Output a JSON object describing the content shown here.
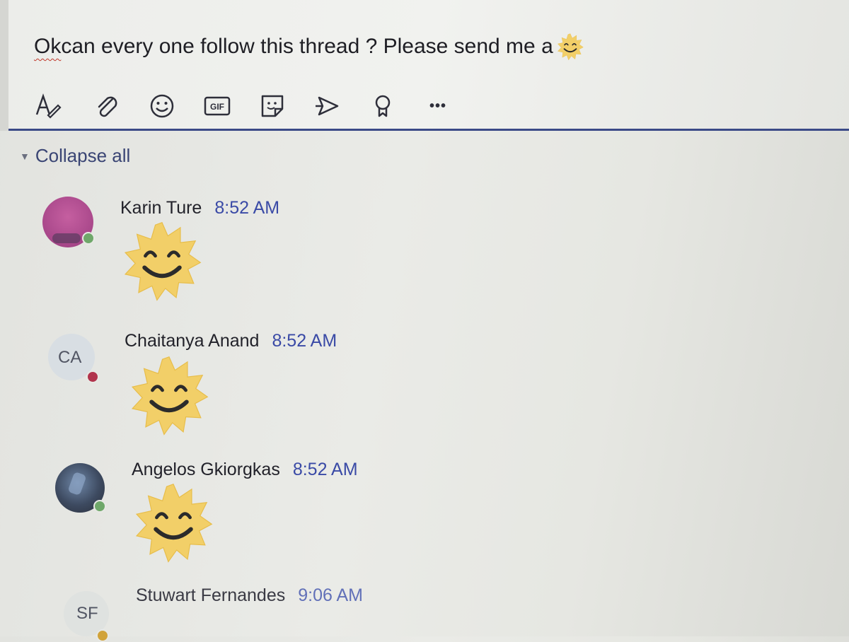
{
  "compose": {
    "text_first_word": "Ok",
    "text_rest": " can every one follow this thread ? Please send me a",
    "inline_emoji": "sun-smile-emoji"
  },
  "toolbar": {
    "items": [
      {
        "icon": "format-icon"
      },
      {
        "icon": "attach-icon"
      },
      {
        "icon": "emoji-icon"
      },
      {
        "icon": "gif-icon",
        "label": "GIF"
      },
      {
        "icon": "sticker-icon"
      },
      {
        "icon": "meet-icon"
      },
      {
        "icon": "praise-icon"
      },
      {
        "icon": "more-icon",
        "label": "•••"
      }
    ]
  },
  "thread": {
    "collapse_label": "Collapse all",
    "messages": [
      {
        "author": "Karin Ture",
        "time": "8:52 AM",
        "avatar": "photo",
        "presence": "available",
        "content": "sun-smile-emoji"
      },
      {
        "author": "Chaitanya Anand",
        "time": "8:52 AM",
        "avatar_initials": "CA",
        "presence": "busy",
        "content": "sun-smile-emoji"
      },
      {
        "author": "Angelos Gkiorgkas",
        "time": "8:52 AM",
        "avatar": "photo",
        "presence": "available",
        "content": "sun-smile-emoji"
      },
      {
        "author": "Stuwart Fernandes",
        "time": "9:06 AM",
        "avatar_initials": "SF",
        "presence": "away"
      }
    ]
  },
  "colors": {
    "accent_line": "#3b4a87",
    "timestamp": "#3a4aa6",
    "sun": "#f2cf68",
    "available": "#6fa86a",
    "busy": "#b1344d",
    "away": "#d1a33a"
  }
}
